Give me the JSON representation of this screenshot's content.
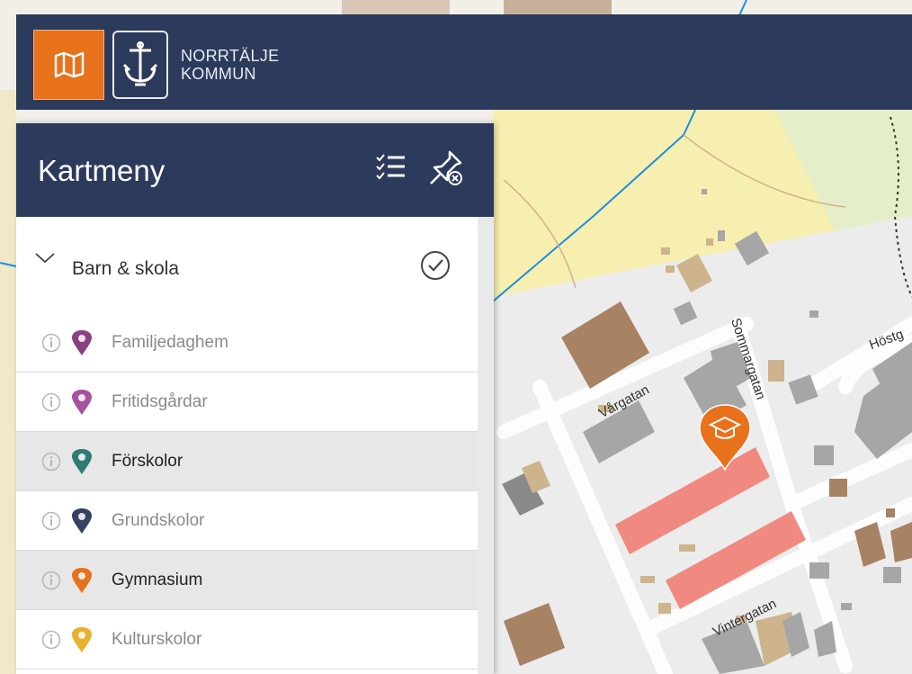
{
  "header": {
    "logo_line1": "NORRTÄLJE",
    "logo_line2": "KOMMUN",
    "map_icon": "map-icon",
    "logo_icon": "anchor-crest-icon"
  },
  "panel": {
    "title": "Kartmeny",
    "list_icon": "checklist-icon",
    "unpin_icon": "pin-off-icon",
    "group": {
      "label": "Barn & skola",
      "expanded": true,
      "all_selected": true
    },
    "layers": [
      {
        "label": "Familjedaghem",
        "active": false,
        "color": "#7b2d72"
      },
      {
        "label": "Fritidsgårdar",
        "active": false,
        "color": "#9c3e94"
      },
      {
        "label": "Förskolor",
        "active": true,
        "color": "#2f7a72"
      },
      {
        "label": "Grundskolor",
        "active": false,
        "color": "#1f2f4f"
      },
      {
        "label": "Gymnasium",
        "active": true,
        "color": "#e8711c"
      },
      {
        "label": "Kulturskolor",
        "active": false,
        "color": "#e6a817"
      }
    ]
  },
  "map": {
    "street_labels": [
      "Vårgatan",
      "Sommargatan",
      "Höstg",
      "Vintergatan"
    ],
    "marker_icon": "graduation-cap-marker-icon",
    "colors": {
      "highlight_building": "#f08a80",
      "building": "#a6a6a6",
      "small_building": "#cdb48c",
      "park": "#f6efb0",
      "road": "#fdfdfd",
      "border_line": "#1e8ee0"
    }
  }
}
